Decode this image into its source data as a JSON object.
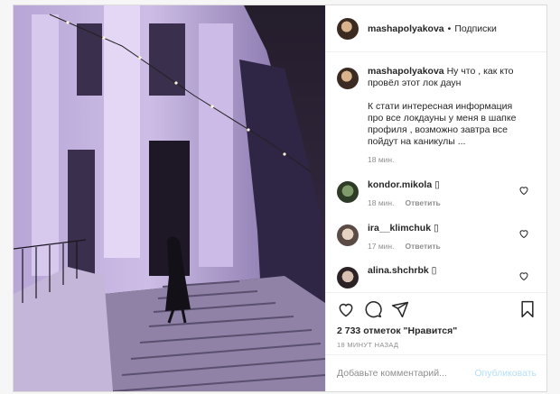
{
  "post": {
    "author": "mashapolyakova",
    "follow": "Подписки",
    "separator": "•"
  },
  "comments": [
    {
      "user": "mashapolyakova",
      "text_first": "Ну что , как кто провёл этот лок даун",
      "text_second": "К стати интересная информация про все локдауны у меня в шапке профиля , возможно завтра все пойдут на каникулы ...",
      "time": "18 мин."
    },
    {
      "user": "kondor.mikola",
      "emoji": "▯",
      "time": "18 мин.",
      "reply": "Ответить"
    },
    {
      "user": "ira__klimchuk",
      "emoji": "▯",
      "time": "17 мин.",
      "reply": "Ответить"
    },
    {
      "user": "alina.shchrbk",
      "emoji": "▯",
      "time": "",
      "reply": ""
    }
  ],
  "likes": "2 733 отметок \"Нравится\"",
  "posted": "18 МИНУТ НАЗАД",
  "add_comment": {
    "placeholder": "Добавьте комментарий...",
    "publish": "Опубликовать"
  },
  "colors": {
    "link_disabled": "#b2dffc",
    "muted": "#8e8e8e",
    "text": "#262626",
    "border": "#dbdbdb"
  },
  "icons": [
    "heart-icon",
    "comment-icon",
    "share-icon",
    "bookmark-icon"
  ]
}
